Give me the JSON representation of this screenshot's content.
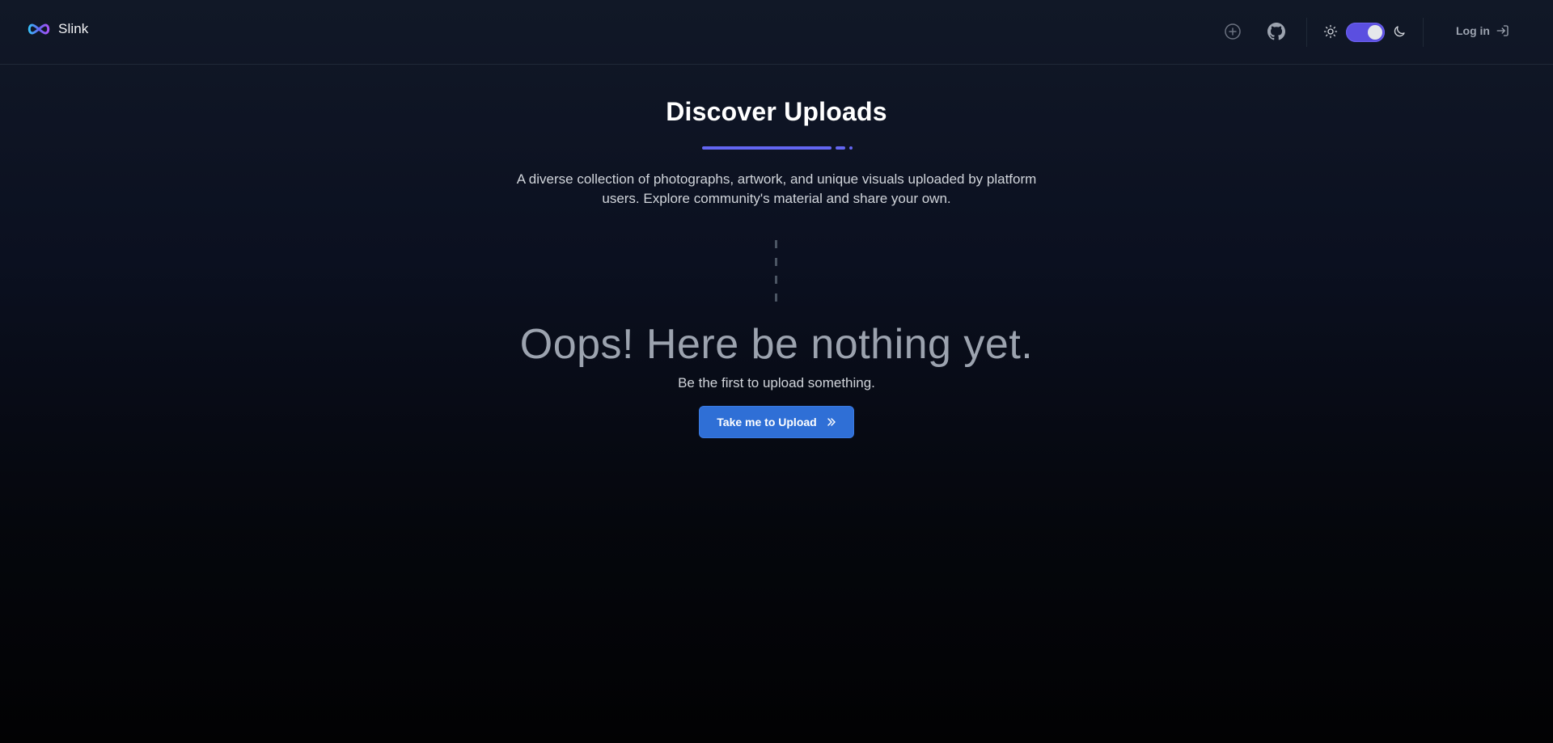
{
  "header": {
    "brand_name": "Slink",
    "icons": [
      "plus-circle-icon",
      "github-icon",
      "sun-icon",
      "moon-icon",
      "login-arrow-icon"
    ],
    "theme_toggle_on": true,
    "login_label": "Log in"
  },
  "main": {
    "title": "Discover Uploads",
    "description": "A diverse collection of photographs, artwork, and unique visuals uploaded by platform users. Explore community's material and share your own.",
    "empty_title": "Oops! Here be nothing yet.",
    "empty_subtitle": "Be the first to upload something.",
    "cta_prefix": "Take me to",
    "cta_bold": "Upload"
  },
  "colors": {
    "accent": "#6366f1",
    "toggle": "#5b4fe0",
    "button": "#2f6fd6",
    "background_top": "#111827",
    "background_bottom": "#020203"
  }
}
